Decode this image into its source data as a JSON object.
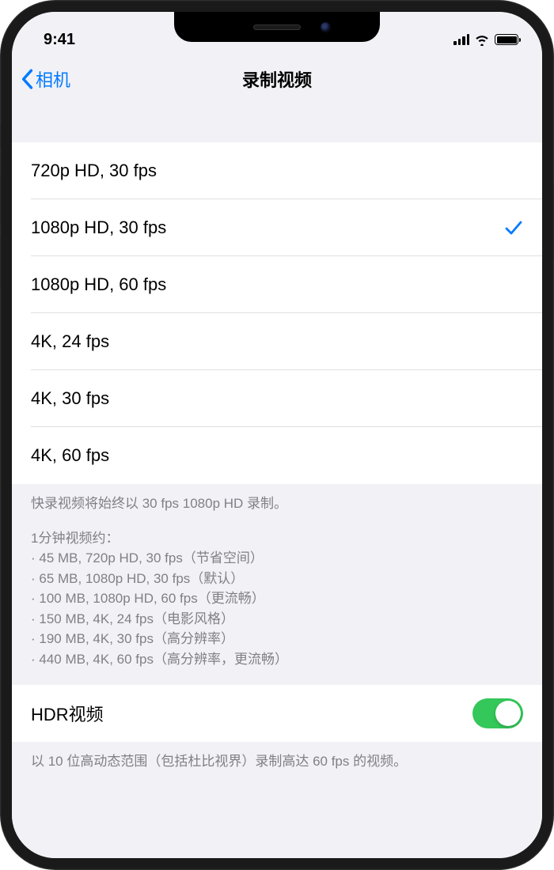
{
  "statusBar": {
    "time": "9:41"
  },
  "nav": {
    "back": "相机",
    "title": "录制视频"
  },
  "resolutions": [
    {
      "label": "720p HD, 30 fps",
      "selected": false
    },
    {
      "label": "1080p HD, 30 fps",
      "selected": true
    },
    {
      "label": "1080p HD, 60 fps",
      "selected": false
    },
    {
      "label": "4K, 24 fps",
      "selected": false
    },
    {
      "label": "4K, 30 fps",
      "selected": false
    },
    {
      "label": "4K, 60 fps",
      "selected": false
    }
  ],
  "footer": {
    "quickNote": "快录视频将始终以 30 fps 1080p HD 录制。",
    "intro": "1分钟视频约：",
    "sizes": [
      "45 MB, 720p HD, 30 fps（节省空间）",
      "65 MB, 1080p HD, 30 fps（默认）",
      "100 MB, 1080p HD, 60 fps（更流畅）",
      "150 MB, 4K, 24 fps（电影风格）",
      "190 MB, 4K, 30 fps（高分辨率）",
      "440 MB, 4K, 60 fps（高分辨率，更流畅）"
    ]
  },
  "hdr": {
    "label": "HDR视频",
    "enabled": true,
    "description": "以 10 位高动态范围（包括杜比视界）录制高达 60 fps 的视频。"
  }
}
